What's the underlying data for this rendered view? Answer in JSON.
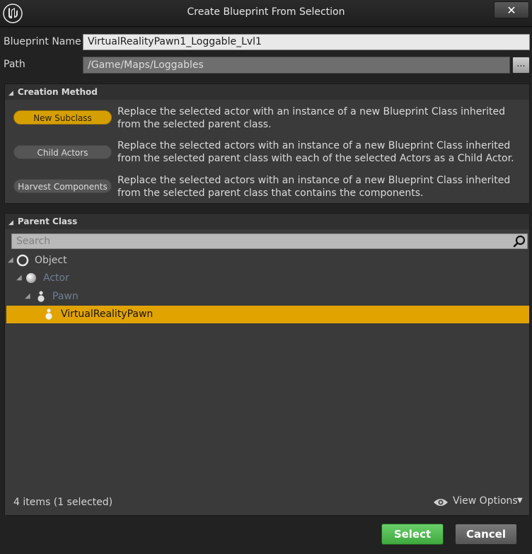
{
  "window": {
    "title": "Create Blueprint From Selection",
    "close_glyph": "✕"
  },
  "form": {
    "name_label": "Blueprint Name",
    "name_value": "VirtualRealityPawn1_Loggable_Lvl1",
    "path_label": "Path",
    "path_value": "/Game/Maps/Loggables",
    "browse_label": "..."
  },
  "creation_method": {
    "header": "Creation Method",
    "options": [
      {
        "label": "New Subclass",
        "selected": true,
        "description": "Replace the selected actor with an instance of a new Blueprint Class inherited from the selected parent class."
      },
      {
        "label": "Child Actors",
        "selected": false,
        "description": "Replace the selected actors with an instance of a new Blueprint Class inherited from the selected parent class with each of the selected Actors as a Child Actor."
      },
      {
        "label": "Harvest Components",
        "selected": false,
        "description": "Replace the selected actors with an instance of a new Blueprint Class inherited from the selected parent class that contains the components."
      }
    ]
  },
  "parent_class": {
    "header": "Parent Class",
    "search_placeholder": "Search",
    "tree": [
      {
        "label": "Object",
        "level": 0,
        "icon": "object-icon",
        "selected": false
      },
      {
        "label": "Actor",
        "level": 1,
        "icon": "actor-icon",
        "selected": false
      },
      {
        "label": "Pawn",
        "level": 2,
        "icon": "pawn-icon",
        "selected": false
      },
      {
        "label": "VirtualRealityPawn",
        "level": 3,
        "icon": "pawn-icon",
        "selected": true
      }
    ],
    "status": "4 items (1 selected)",
    "view_options": "View Options"
  },
  "footer": {
    "select_label": "Select",
    "cancel_label": "Cancel"
  },
  "colors": {
    "accent": "#e0a300",
    "select_button": "#4fbf4f"
  }
}
